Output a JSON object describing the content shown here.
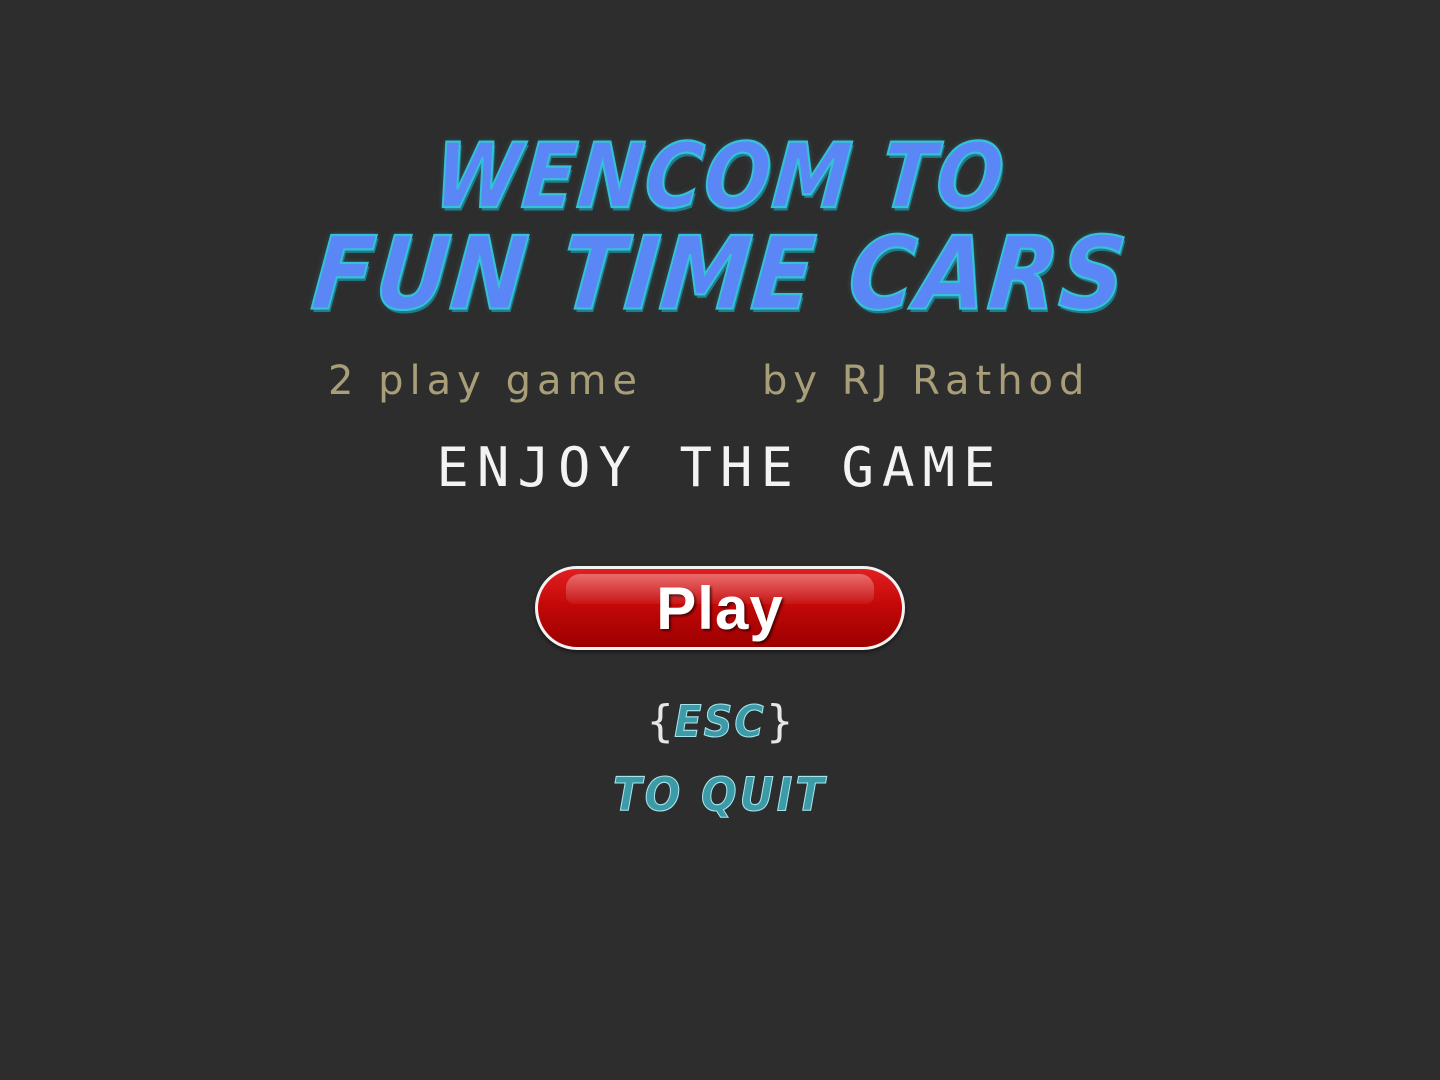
{
  "title": {
    "line1": "WENCOM TO",
    "line2": "FUN TIME CARS"
  },
  "credits": {
    "left": "2 play game",
    "right": "by RJ Rathod"
  },
  "tagline": "ENJOY THE GAME",
  "play_button": {
    "label": "Play"
  },
  "quit_hint": {
    "brace_open": "{",
    "key": "ESC",
    "brace_close": "}",
    "text": "TO QUIT"
  },
  "colors": {
    "background": "#2d2d2d",
    "title_fill": "#5a86f6",
    "title_outline": "#33c2d8",
    "credits": "#a89f79",
    "tagline": "#f3f3f3",
    "play_button": "#c40808",
    "quit_text": "#3d9ba7"
  }
}
